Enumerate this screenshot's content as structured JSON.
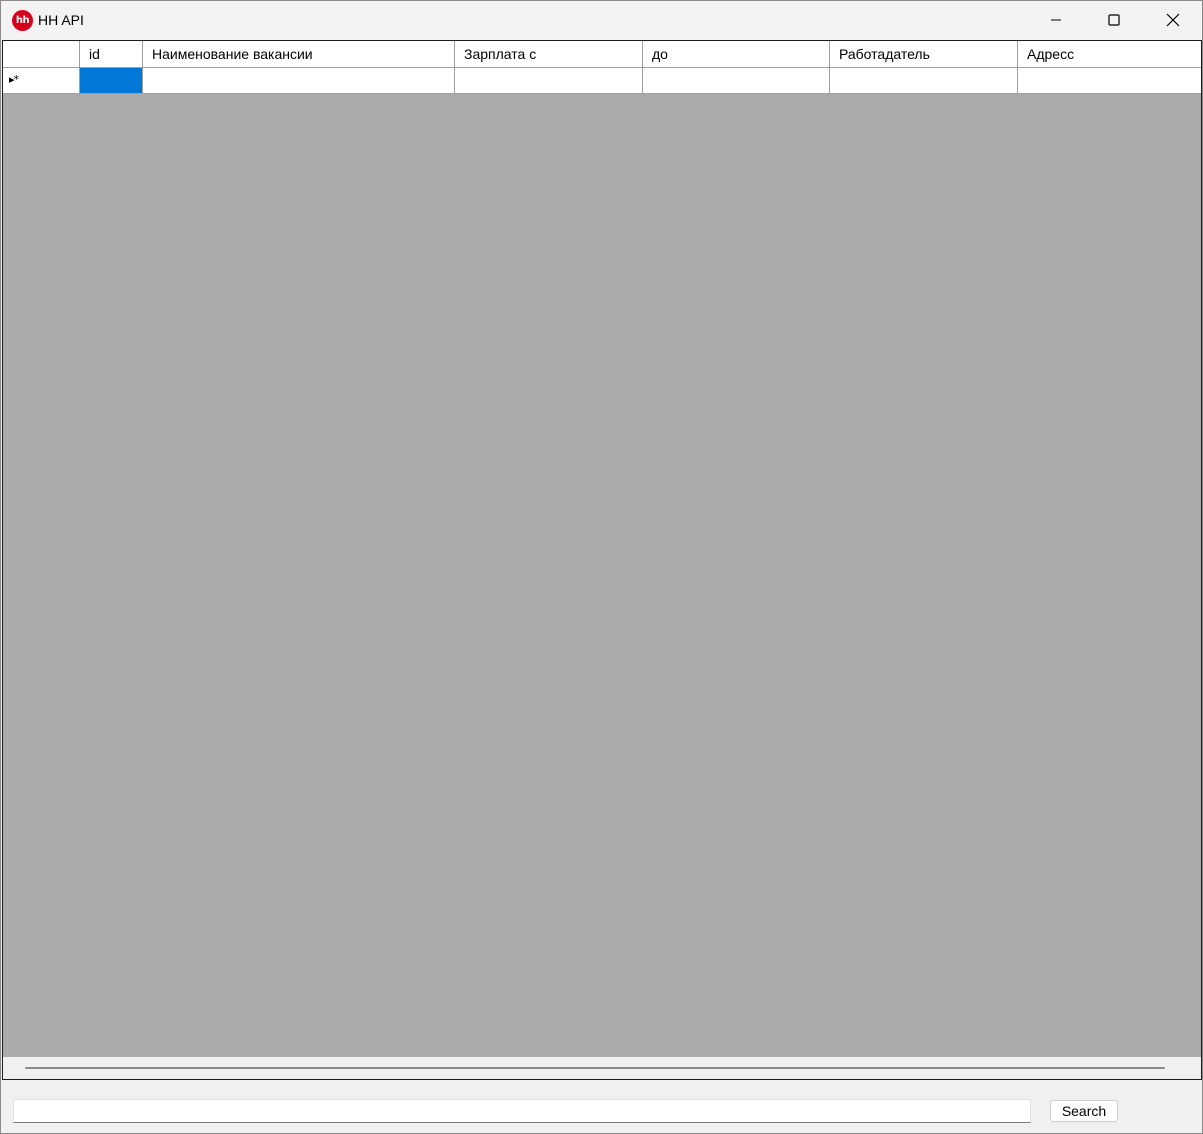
{
  "window": {
    "title": "HH API",
    "logo_text": "hh",
    "logo_color": "#d6001c"
  },
  "grid": {
    "columns": [
      {
        "key": "rowheader",
        "label": ""
      },
      {
        "key": "id",
        "label": "id"
      },
      {
        "key": "name",
        "label": "Наименование вакансии"
      },
      {
        "key": "salary_from",
        "label": "Зарплата с"
      },
      {
        "key": "salary_to",
        "label": "до"
      },
      {
        "key": "employer",
        "label": "Работадатель"
      },
      {
        "key": "address",
        "label": "Адресс"
      }
    ],
    "new_row_glyph": "▸*",
    "selection_color": "#0078d7",
    "background_color": "#ababab"
  },
  "search": {
    "value": "",
    "button_label": "Search"
  },
  "icons": {
    "minimize": "minimize-icon",
    "maximize": "maximize-icon",
    "close": "close-icon"
  }
}
